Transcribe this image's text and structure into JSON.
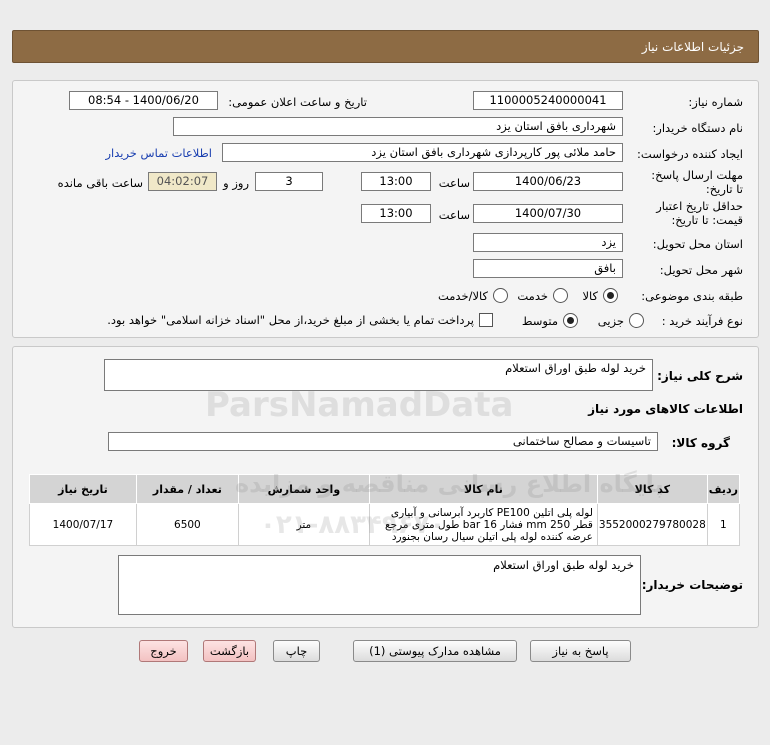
{
  "header": {
    "title": "جزئیات اطلاعات نیاز"
  },
  "form": {
    "need_number_label": "شماره نیاز:",
    "need_number": "1100005240000041",
    "announce_label": "تاریخ و ساعت اعلان عمومی:",
    "announce_value": "1400/06/20 - 08:54",
    "buyer_org_label": "نام دستگاه خریدار:",
    "buyer_org": "شهرداری بافق استان یزد",
    "creator_label": "ایجاد کننده درخواست:",
    "creator": "حامد ملائی پور کارپردازی شهرداری بافق استان یزد",
    "contact_link": "اطلاعات تماس خریدار",
    "deadline_label": "مهلت ارسال پاسخ: تا تاریخ:",
    "deadline_date": "1400/06/23",
    "time_label": "ساعت",
    "deadline_time": "13:00",
    "days_value": "3",
    "days_label": "روز و",
    "remaining_time": "04:02:07",
    "remaining_label": "ساعت باقی مانده",
    "validity_label": "حداقل تاریخ اعتبار قیمت: تا تاریخ:",
    "validity_date": "1400/07/30",
    "validity_time": "13:00",
    "province_label": "استان محل تحویل:",
    "province": "یزد",
    "city_label": "شهر محل تحویل:",
    "city": "بافق",
    "category_label": "طبقه بندی موضوعی:",
    "category_options": [
      "کالا",
      "خدمت",
      "کالا/خدمت"
    ],
    "process_label": "نوع فرآیند خرید :",
    "process_options": [
      "جزیی",
      "متوسط"
    ],
    "payment_note": "پرداخت تمام یا بخشی از مبلغ خرید،از محل \"اسناد خزانه اسلامی\" خواهد بود."
  },
  "details": {
    "summary_label": "شرح کلی نیاز:",
    "summary": "خرید لوله طبق اوراق استعلام",
    "items_title": "اطلاعات کالاهای مورد نیاز",
    "group_label": "گروه کالا:",
    "group": "تاسیسات و مصالح ساختمانی",
    "table": {
      "headers": [
        "ردیف",
        "کد کالا",
        "نام کالا",
        "واحد شمارش",
        "تعداد / مقدار",
        "تاریخ نیاز"
      ],
      "rows": [
        [
          "1",
          "3552000279780028",
          "لوله پلی اتلین PE100 کاربرد آبرسانی و آبیاری قطر 250 mm فشار 16 bar طول متری مرجع عرضه کننده لوله پلی اتیلن سیال رسان بجنورد",
          "متر",
          "6500",
          "1400/07/17"
        ]
      ]
    },
    "buyer_notes_label": "توضیحات خریدار:",
    "buyer_notes": "خرید لوله طبق اوراق استعلام"
  },
  "buttons": {
    "reply": "پاسخ به نیاز",
    "attachments": "مشاهده مدارک پیوستی (1)",
    "print": "چاپ",
    "back": "بازگشت",
    "exit": "خروج"
  },
  "watermark": {
    "brand": "ParsNamadData",
    "slogan": "پایگاه اطلاع رسانی مناقصه و مزایده",
    "phone": "۰۲۱-۸۸۳۴۹۶۷۰"
  },
  "colors": {
    "header_bg": "#8d6b44",
    "remaining_bg": "#f0e8c8",
    "link": "#1a3fb0"
  }
}
